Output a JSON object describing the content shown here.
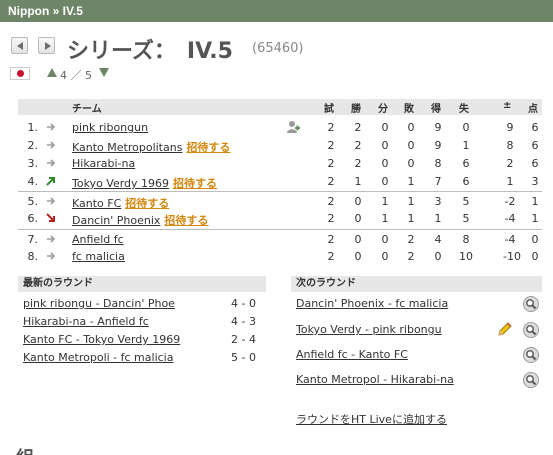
{
  "breadcrumb": "Nippon » IV.5",
  "series": {
    "title": "シリーズ：　IV.5",
    "id": "(65460)"
  },
  "level": {
    "text": "4 ／ 5"
  },
  "table": {
    "headers": {
      "team": "チーム",
      "played": "試",
      "won": "勝",
      "draw": "分",
      "lost": "敗",
      "gf": "得",
      "ga": "失",
      "diff": "±",
      "pts": "点"
    },
    "rows": [
      {
        "pos": "1.",
        "trend": "same",
        "team": "pink ribongun",
        "invite": "",
        "played": "2",
        "won": "2",
        "draw": "0",
        "lost": "0",
        "gf": "9",
        "ga": "0",
        "diff": "9",
        "pts": "6"
      },
      {
        "pos": "2.",
        "trend": "same",
        "team": "Kanto Metropolitans",
        "invite": "招待する",
        "played": "2",
        "won": "2",
        "draw": "0",
        "lost": "0",
        "gf": "9",
        "ga": "1",
        "diff": "8",
        "pts": "6"
      },
      {
        "pos": "3.",
        "trend": "same",
        "team": "Hikarabi-na",
        "invite": "",
        "played": "2",
        "won": "2",
        "draw": "0",
        "lost": "0",
        "gf": "8",
        "ga": "6",
        "diff": "2",
        "pts": "6"
      },
      {
        "pos": "4.",
        "trend": "up",
        "team": "Tokyo Verdy 1969",
        "invite": "招待する",
        "played": "2",
        "won": "1",
        "draw": "0",
        "lost": "1",
        "gf": "7",
        "ga": "6",
        "diff": "1",
        "pts": "3"
      },
      {
        "pos": "5.",
        "trend": "same",
        "team": "Kanto FC",
        "invite": "招待する",
        "played": "2",
        "won": "0",
        "draw": "1",
        "lost": "1",
        "gf": "3",
        "ga": "5",
        "diff": "-2",
        "pts": "1"
      },
      {
        "pos": "6.",
        "trend": "down",
        "team": "Dancin' Phoenix",
        "invite": "招待する",
        "played": "2",
        "won": "0",
        "draw": "1",
        "lost": "1",
        "gf": "1",
        "ga": "5",
        "diff": "-4",
        "pts": "1"
      },
      {
        "pos": "7.",
        "trend": "same",
        "team": "Anfield fc",
        "invite": "",
        "played": "2",
        "won": "0",
        "draw": "0",
        "lost": "2",
        "gf": "4",
        "ga": "8",
        "diff": "-4",
        "pts": "0"
      },
      {
        "pos": "8.",
        "trend": "same",
        "team": "fc malicia",
        "invite": "",
        "played": "2",
        "won": "0",
        "draw": "0",
        "lost": "2",
        "gf": "0",
        "ga": "10",
        "diff": "-10",
        "pts": "0"
      }
    ]
  },
  "latest_round": {
    "title": "最新のラウンド",
    "matches": [
      {
        "teams": "pink ribongu - Dancin' Phoe",
        "score": "4 - 0"
      },
      {
        "teams": "Hikarabi-na - Anfield fc",
        "score": "4 - 3"
      },
      {
        "teams": "Kanto FC - Tokyo Verdy 1969",
        "score": "2 - 4"
      },
      {
        "teams": "Kanto Metropoli - fc malicia",
        "score": "5 - 0"
      }
    ]
  },
  "next_round": {
    "title": "次のラウンド",
    "matches": [
      {
        "teams": "Dancin' Phoenix - fc malicia"
      },
      {
        "teams": "Tokyo Verdy  - pink ribongu"
      },
      {
        "teams": "Anfield fc - Kanto FC"
      },
      {
        "teams": "Kanto Metropol - Hikarabi-na"
      }
    ],
    "add_link": "ラウンドをHT Liveに追加する"
  },
  "footer_partial": "組",
  "colors": {
    "topbar": "#6f8568",
    "invite": "#d4870c",
    "header_bg": "#e7e7e7",
    "up_arrow": "#2e8b2e",
    "down_arrow": "#b22222",
    "same_arrow": "#9a9a9a"
  },
  "icons": {
    "prev": "triangle-left-icon",
    "next": "triangle-right-icon",
    "flag": "japan-flag-icon",
    "magnifier": "magnifier-icon",
    "pencil": "pencil-icon",
    "invite_person": "person-invite-icon"
  }
}
